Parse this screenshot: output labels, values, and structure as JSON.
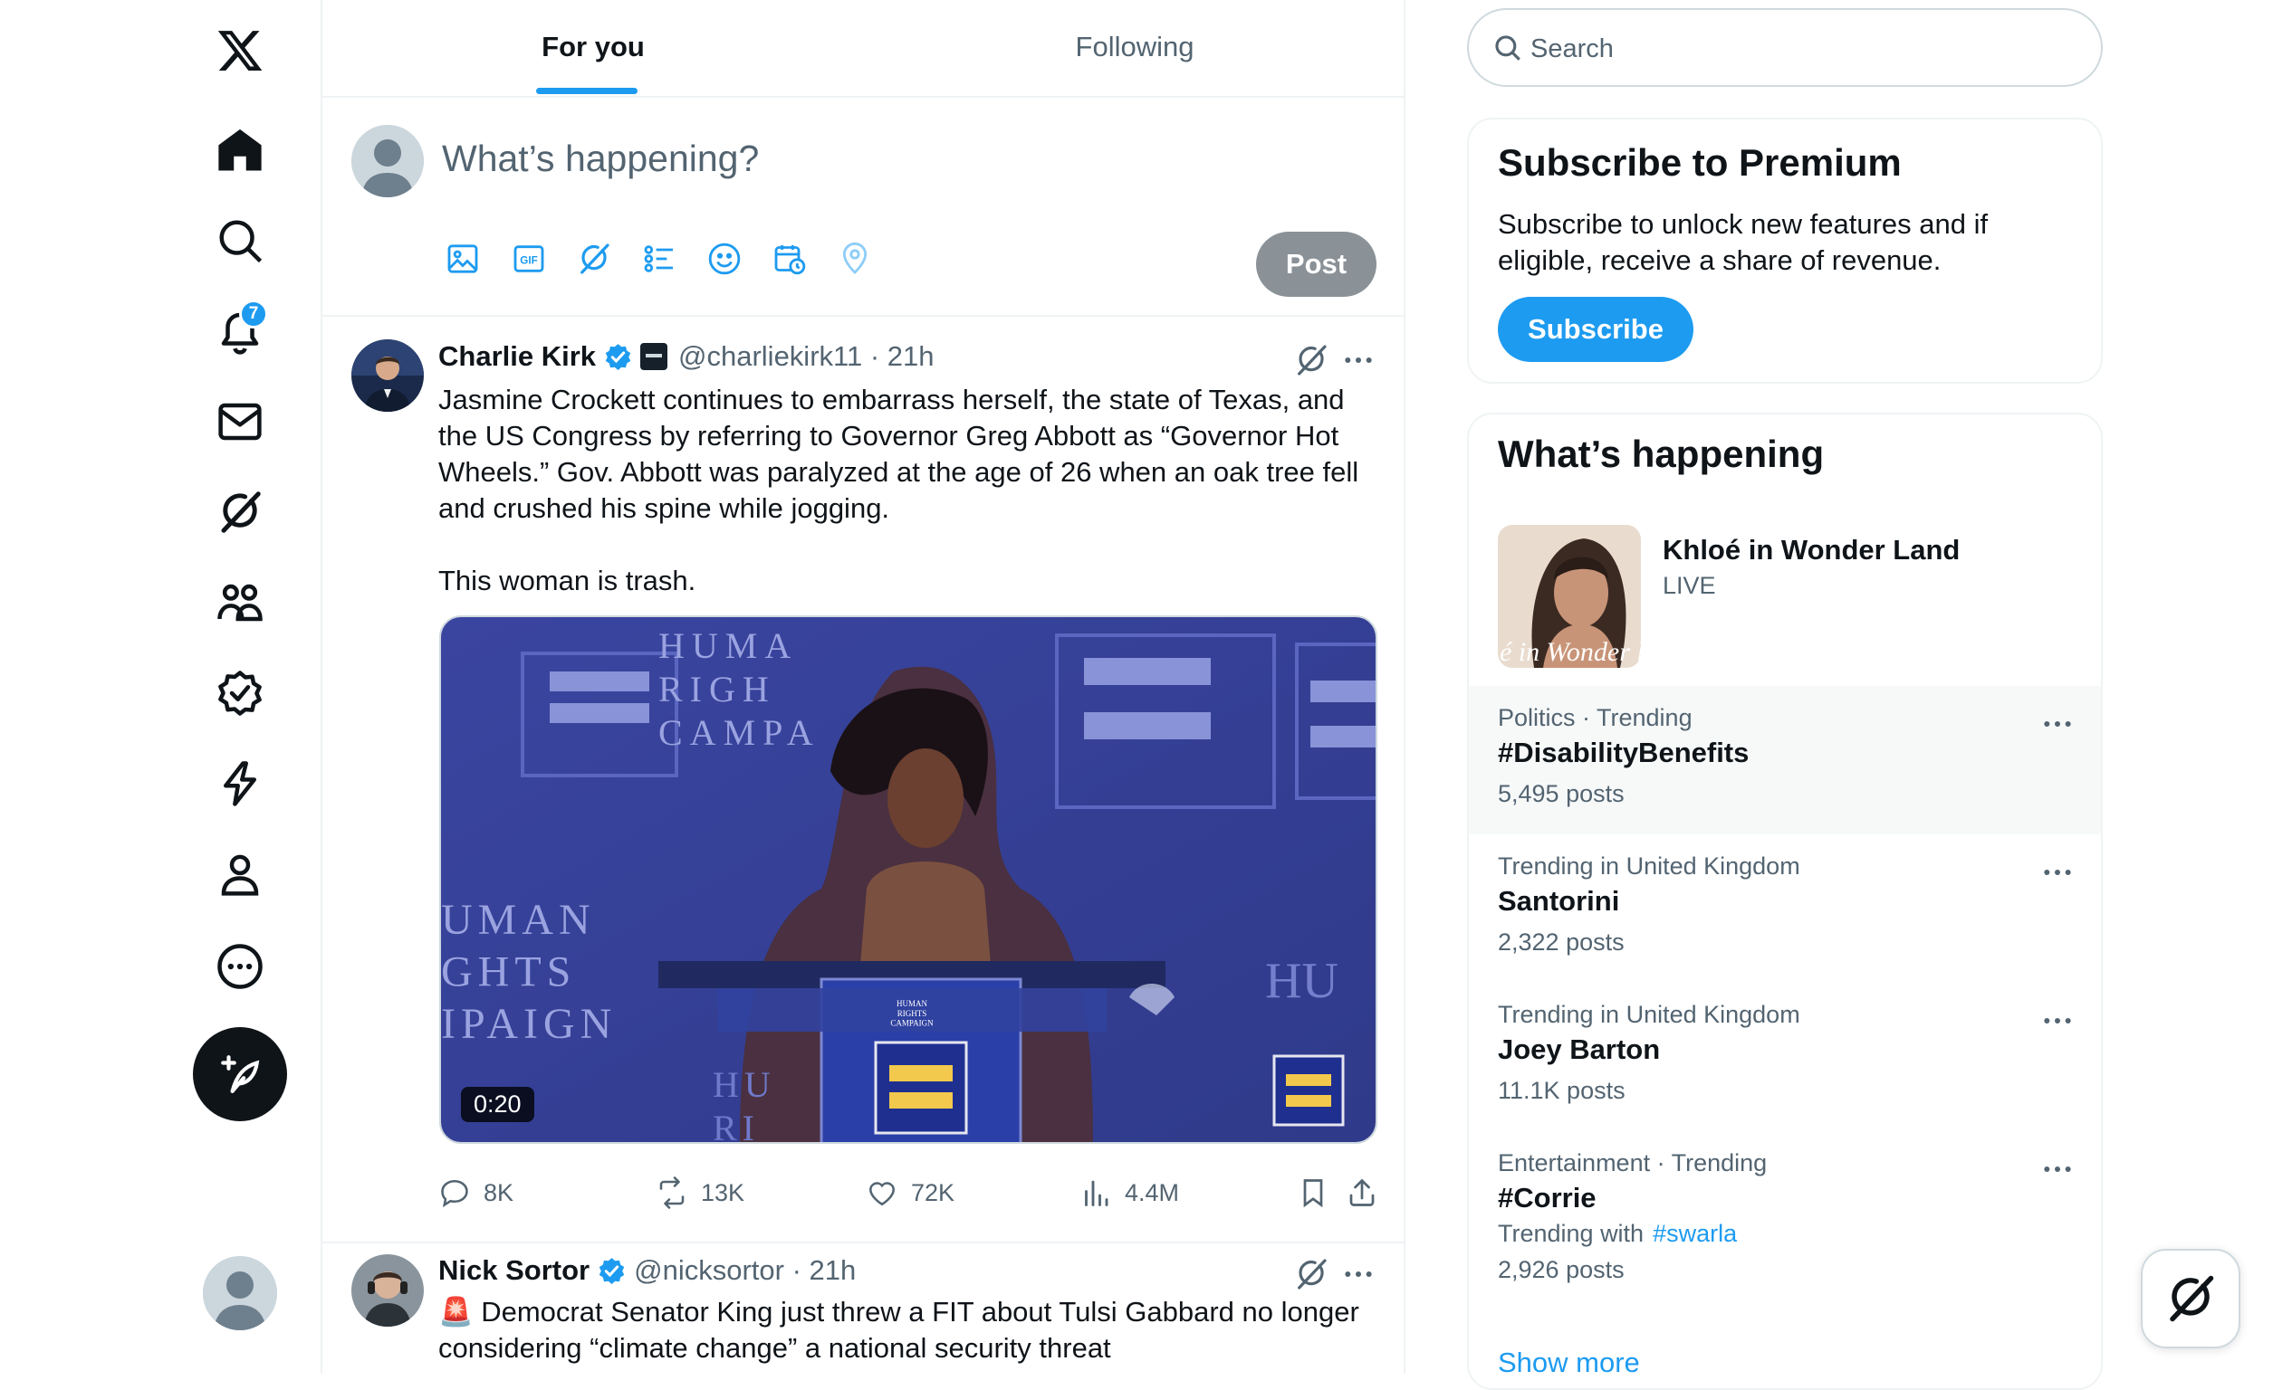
{
  "colors": {
    "accent": "#1d9bf0",
    "text": "#0f1419",
    "muted": "#536471",
    "post_disabled": "#8a9297"
  },
  "nav": {
    "items": [
      {
        "id": "home",
        "icon": "home-icon"
      },
      {
        "id": "explore",
        "icon": "search-icon"
      },
      {
        "id": "notifications",
        "icon": "bell-icon",
        "badge": "7"
      },
      {
        "id": "messages",
        "icon": "envelope-icon"
      },
      {
        "id": "grok",
        "icon": "grok-icon"
      },
      {
        "id": "communities",
        "icon": "people-icon"
      },
      {
        "id": "premium",
        "icon": "verified-badge-icon"
      },
      {
        "id": "verified-orgs",
        "icon": "lightning-icon"
      },
      {
        "id": "profile",
        "icon": "person-icon"
      },
      {
        "id": "more",
        "icon": "more-circle-icon"
      }
    ],
    "notifications_badge": "7"
  },
  "tabs": [
    {
      "label": "For you",
      "active": true
    },
    {
      "label": "Following",
      "active": false
    }
  ],
  "composer": {
    "placeholder": "What’s happening?",
    "post_label": "Post",
    "tools": [
      "image-icon",
      "gif-icon",
      "grok-icon",
      "poll-icon",
      "emoji-icon",
      "schedule-icon",
      "location-icon"
    ]
  },
  "tweets": [
    {
      "name": "Charlie Kirk",
      "handle": "@charliekirk11",
      "time": "21h",
      "verified": true,
      "text": "Jasmine Crockett continues to embarrass herself, the state of Texas, and the US Congress by referring to Governor Greg Abbott as “Governor Hot Wheels.” Gov. Abbott was paralyzed at the age of 26 when an oak tree fell and crushed his spine while jogging.\n\nThis woman is trash.",
      "media": {
        "duration": "0:20",
        "banner_top": "HUMA\nRIGH\nCAMPA",
        "banner_left": "UMAN\nGHTS\nIPAIGN",
        "banner_right": "HU",
        "podium_text": "HUMAN\nRIGHTS\nCAMPAIGN",
        "podium_lower": "HU\nRI\nCA"
      },
      "stats": {
        "replies": "8K",
        "reposts": "13K",
        "likes": "72K",
        "views": "4.4M"
      }
    },
    {
      "name": "Nick Sortor",
      "handle": "@nicksortor",
      "time": "21h",
      "verified": true,
      "text": "🚨 Democrat Senator King just threw a FIT about Tulsi Gabbard no longer considering “climate change” a national security threat"
    }
  ],
  "search": {
    "placeholder": "Search"
  },
  "premium": {
    "title": "Subscribe to Premium",
    "body": "Subscribe to unlock new features and if eligible, receive a share of revenue.",
    "button": "Subscribe"
  },
  "happening": {
    "title": "What’s happening",
    "live": {
      "title": "Khloé in Wonder Land",
      "status": "LIVE",
      "thumb_text": "é in Wonder l"
    },
    "trends": [
      {
        "context": "Politics · Trending",
        "name": "#DisabilityBenefits",
        "count": "5,495 posts"
      },
      {
        "context": "Trending in United Kingdom",
        "name": "Santorini",
        "count": "2,322 posts"
      },
      {
        "context": "Trending in United Kingdom",
        "name": "Joey Barton",
        "count": "11.1K posts"
      },
      {
        "context": "Entertainment · Trending",
        "name": "#Corrie",
        "extra_label": "Trending with",
        "extra_tag": "#swarla",
        "count": "2,926 posts"
      }
    ],
    "show_more": "Show more"
  }
}
